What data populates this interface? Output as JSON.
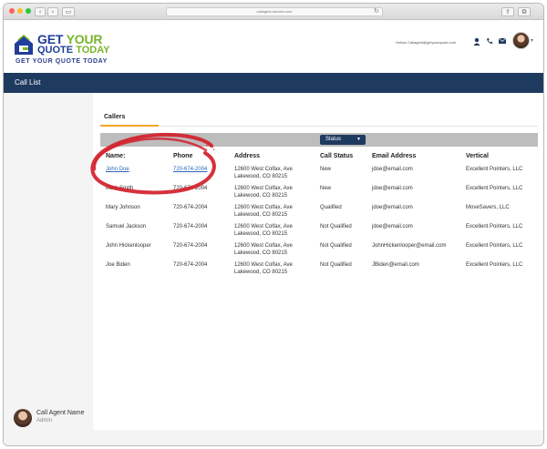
{
  "browser": {
    "url": "callagent.domain.com",
    "nav_back_icon": "chevron-left-icon",
    "nav_forward_icon": "chevron-right-icon"
  },
  "brand": {
    "logo_line1a": "GET",
    "logo_line1b": "YOUR",
    "logo_line2a": "QUOTE",
    "logo_line2b": "TODAY",
    "tagline": "GET YOUR QUOTE TODAY",
    "primary_color": "#1f3d99",
    "accent_color": "#7ab42c"
  },
  "header": {
    "greeting": "Hellow Callagent@getyourquote.com",
    "icons": [
      "user-icon",
      "phone-icon",
      "mail-icon"
    ]
  },
  "page": {
    "title": "Call List"
  },
  "tabs": {
    "callers": "Callers"
  },
  "filter": {
    "status_label": "Status"
  },
  "table": {
    "headers": {
      "name": "Name:",
      "phone": "Phone",
      "address": "Address",
      "call_status": "Call Status",
      "email": "Email Address",
      "vertical": "Vertical"
    },
    "rows": [
      {
        "name": "John Doe",
        "phone": "720-674-2004",
        "address1": "12600 West Colfax, Ave",
        "address2": "Lakewood, CO 80215",
        "status": "New",
        "email": "jdoe@email.com",
        "vertical": "Excellent Pointers, LLC"
      },
      {
        "name": "Mark Smith",
        "phone": "720-674-2004",
        "address1": "12600 West Colfax, Ave",
        "address2": "Lakewood, CO 80215",
        "status": "New",
        "email": "jdoe@email.com",
        "vertical": "Excellent Pointers, LLC"
      },
      {
        "name": "Mary Johnson",
        "phone": "720-674-2004",
        "address1": "12600 West Colfax, Ave",
        "address2": "Lakewood, CO 80215",
        "status": "Qualified",
        "email": "jdoe@email.com",
        "vertical": "MoveSavers, LLC"
      },
      {
        "name": "Samuel Jackson",
        "phone": "720-674-2004",
        "address1": "12600 West Colfax, Ave",
        "address2": "Lakewood, CO 80215",
        "status": "Not Qualified",
        "email": "jdoe@email.com",
        "vertical": "Excellent Pointers, LLC"
      },
      {
        "name": "John Hickenlooper",
        "phone": "720-674-2004",
        "address1": "12600 West Colfax, Ave",
        "address2": "Lakewood, CO 80215",
        "status": "Not Qualified",
        "email": "JohnHickenlooper@email.com",
        "vertical": "Excellent Pointers, LLC"
      },
      {
        "name": "Joe Biden",
        "phone": "720-674-2004",
        "address1": "12600 West Colfax, Ave",
        "address2": "Lakewood, CO 80215",
        "status": "Not Qualified",
        "email": "JBiden@email.com",
        "vertical": "Excellent Pointers, LLC"
      }
    ]
  },
  "agent": {
    "name": "Call Agent Name",
    "role": "Admin"
  },
  "annotation": {
    "highlight_color": "#d21f2b"
  }
}
